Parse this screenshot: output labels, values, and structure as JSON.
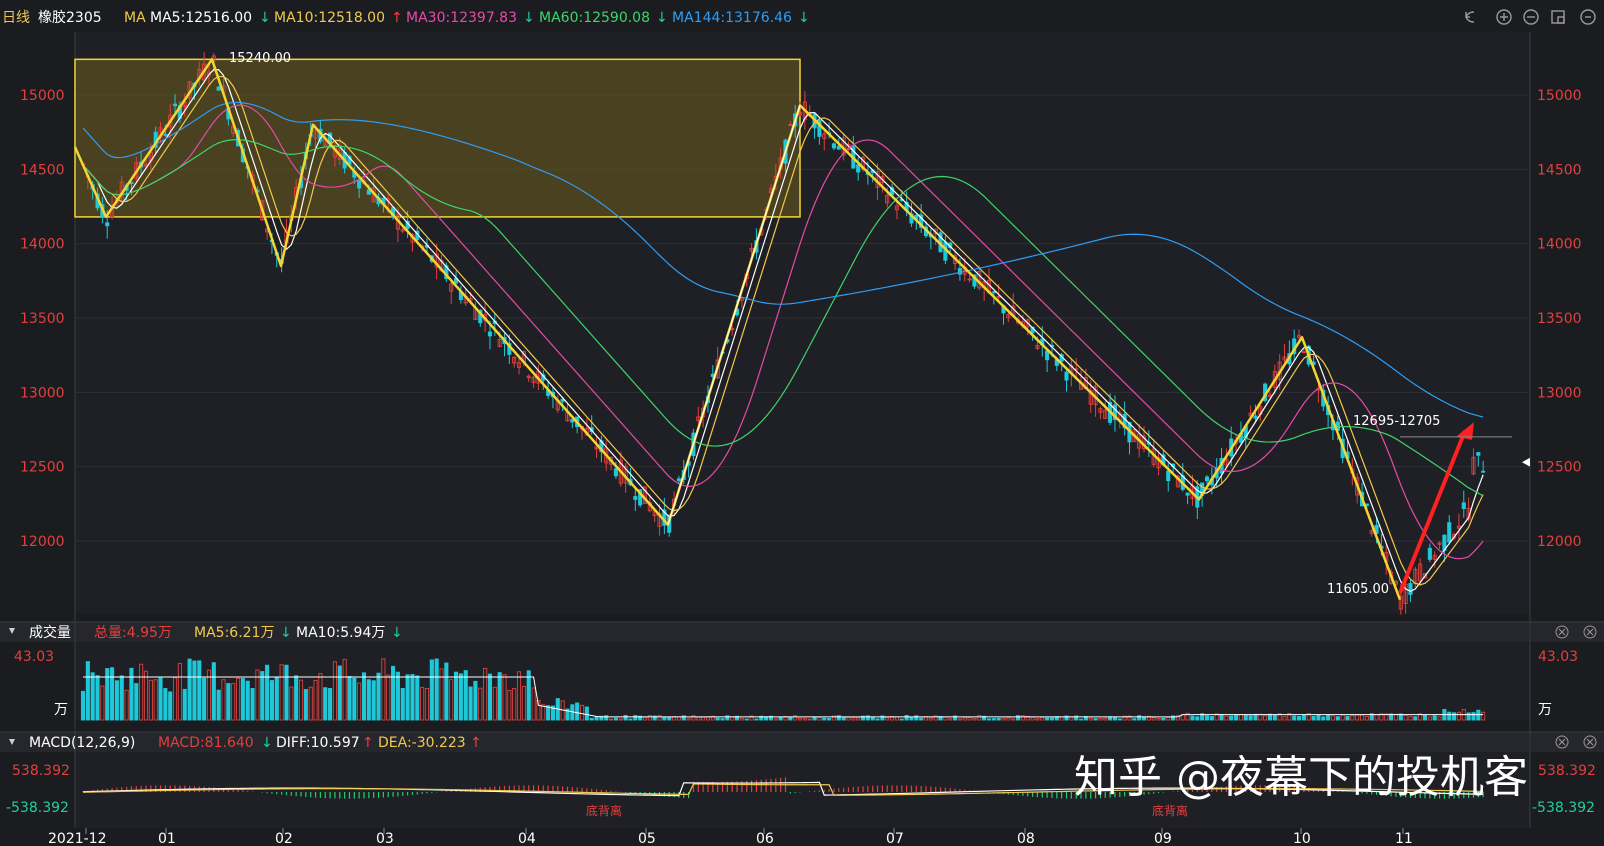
{
  "header": {
    "period": "日线",
    "symbol": "橡胶2305",
    "ma_prefix": "MA",
    "ma5": {
      "label": "MA5:12516.00",
      "dir": "↓",
      "color": "#ffffff",
      "arrow_color": "#1ecfa0"
    },
    "ma10": {
      "label": "MA10:12518.00",
      "dir": "↑",
      "color": "#f2c94c",
      "arrow_color": "#ff3b3b"
    },
    "ma30": {
      "label": "MA30:12397.83",
      "dir": "↓",
      "color": "#e64aa8",
      "arrow_color": "#1ecfa0"
    },
    "ma60": {
      "label": "MA60:12590.08",
      "dir": "↓",
      "color": "#3fd46a",
      "arrow_color": "#1ecfa0"
    },
    "ma144": {
      "label": "MA144:13176.46",
      "dir": "↓",
      "color": "#2f9df4",
      "arrow_color": "#1ecfa0"
    }
  },
  "price_axis": {
    "ticks": [
      "15000",
      "14500",
      "14000",
      "13500",
      "13000",
      "12500",
      "12000"
    ]
  },
  "annotations": {
    "high_label": "15240.00",
    "low_label": "11605.00",
    "range_label": "12695-12705"
  },
  "volume_panel": {
    "title": "成交量",
    "total": "总量:4.95万",
    "ma5": "MA5:6.21万",
    "ma5_dir": "↓",
    "ma10": "MA10:5.94万",
    "ma10_dir": "↓",
    "max_label": "43.03",
    "unit": "万"
  },
  "macd_panel": {
    "title": "MACD(12,26,9)",
    "macd": "MACD:81.640",
    "macd_dir": "↓",
    "diff": "DIFF:10.597",
    "diff_dir": "↑",
    "dea": "DEA:-30.223",
    "dea_dir": "↑",
    "top_label": "538.392",
    "bottom_label": "-538.392",
    "divergence_label": "底背离"
  },
  "date_axis": [
    "2021-12",
    "01",
    "02",
    "03",
    "04",
    "05",
    "06",
    "07",
    "08",
    "09",
    "10",
    "11"
  ],
  "watermark": "知乎 @夜幕下的投机客",
  "colors": {
    "up": "#e2403c",
    "down": "#1ec8d8",
    "zigzag": "#f2d634",
    "box_fill": "#6b5c1e"
  },
  "chart_data": {
    "type": "candlestick",
    "title": "橡胶2305",
    "ylim": [
      11500,
      15300
    ],
    "x": [
      "2021-12",
      "01",
      "02",
      "03",
      "04",
      "05",
      "06",
      "07",
      "08",
      "09",
      "10",
      "11"
    ],
    "zigzag_pivots": [
      14650,
      14180,
      15240,
      13850,
      14800,
      12110,
      14930,
      12280,
      13370,
      11605
    ],
    "high": 15240,
    "low": 11605,
    "ma_lines": {
      "MA5": 12516.0,
      "MA10": 12518.0,
      "MA30": 12397.83,
      "MA60": 12590.08,
      "MA144": 13176.46
    },
    "volume_max": 43.03,
    "macd_range": [
      -538.392,
      538.392
    ]
  }
}
